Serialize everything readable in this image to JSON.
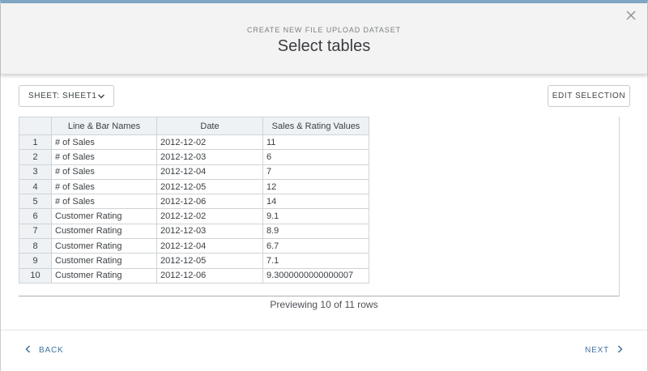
{
  "header": {
    "subtitle": "CREATE NEW FILE UPLOAD DATASET",
    "title": "Select tables"
  },
  "icons": {
    "close": "close-icon",
    "sheet_dropdown": "chevron-down-icon",
    "back": "chevron-left-icon",
    "next": "chevron-right-icon"
  },
  "toolbar": {
    "sheet_label": "SHEET: SHEET1",
    "edit_selection_label": "EDIT SELECTION"
  },
  "table": {
    "columns": [
      "Line & Bar Names",
      "Date",
      "Sales & Rating Values"
    ],
    "rows": [
      {
        "index": "1",
        "cells": [
          "# of Sales",
          "2012-12-02",
          "11"
        ]
      },
      {
        "index": "2",
        "cells": [
          "# of Sales",
          "2012-12-03",
          "6"
        ]
      },
      {
        "index": "3",
        "cells": [
          "# of Sales",
          "2012-12-04",
          "7"
        ]
      },
      {
        "index": "4",
        "cells": [
          "# of Sales",
          "2012-12-05",
          "12"
        ]
      },
      {
        "index": "5",
        "cells": [
          "# of Sales",
          "2012-12-06",
          "14"
        ]
      },
      {
        "index": "6",
        "cells": [
          "Customer Rating",
          "2012-12-02",
          "9.1"
        ]
      },
      {
        "index": "7",
        "cells": [
          "Customer Rating",
          "2012-12-03",
          "8.9"
        ]
      },
      {
        "index": "8",
        "cells": [
          "Customer Rating",
          "2012-12-04",
          "6.7"
        ]
      },
      {
        "index": "9",
        "cells": [
          "Customer Rating",
          "2012-12-05",
          "7.1"
        ]
      },
      {
        "index": "10",
        "cells": [
          "Customer Rating",
          "2012-12-06",
          "9.3000000000000007"
        ]
      }
    ]
  },
  "preview_text": "Previewing 10 of 11 rows",
  "footer": {
    "back_label": "BACK",
    "next_label": "NEXT"
  },
  "colors": {
    "accent": "#3f73a3",
    "header_bg": "#f3f3f3",
    "table_header_bg": "#eef2f4"
  }
}
